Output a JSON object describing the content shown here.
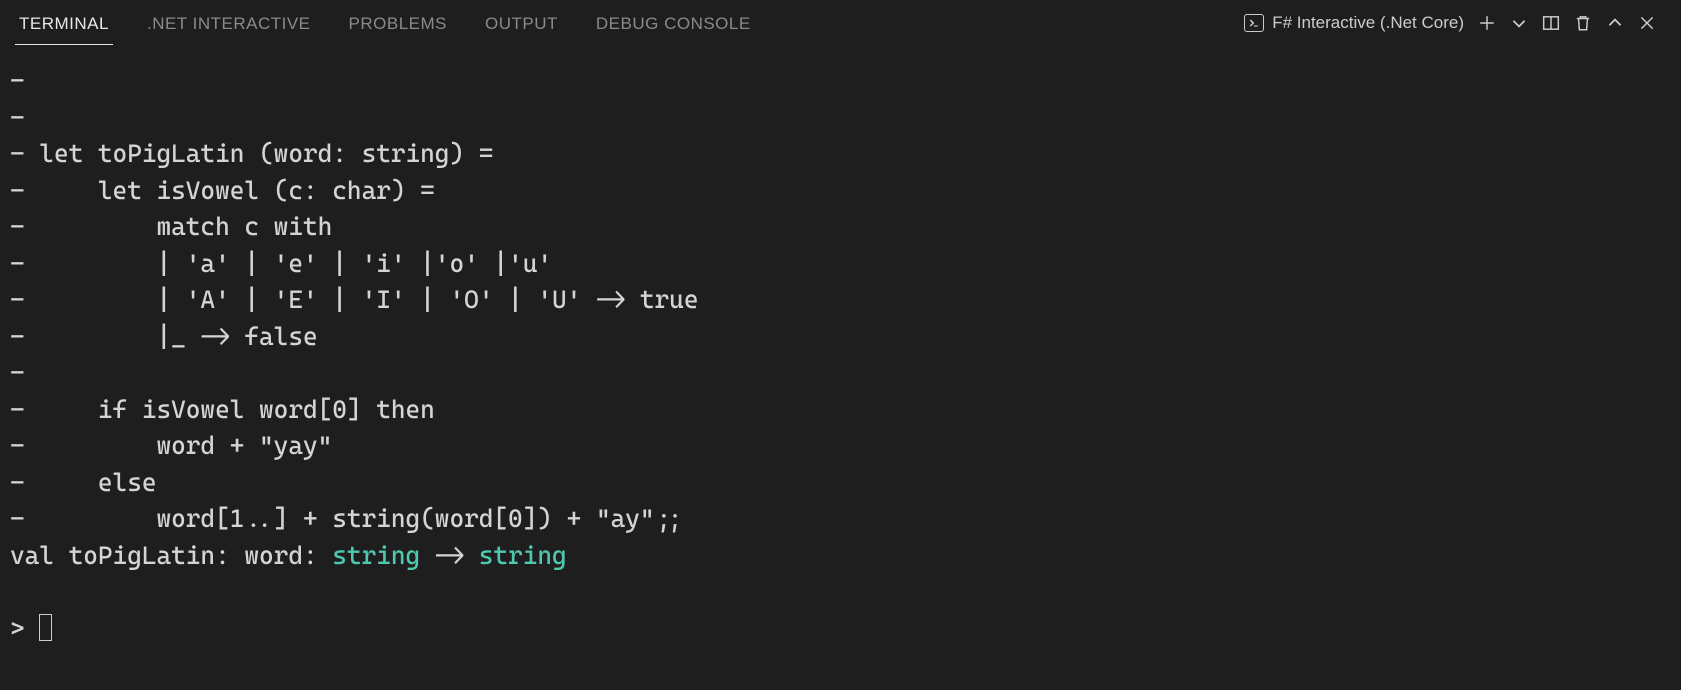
{
  "tabs": {
    "items": [
      {
        "label": "TERMINAL",
        "active": true
      },
      {
        "label": ".NET INTERACTIVE",
        "active": false
      },
      {
        "label": "PROBLEMS",
        "active": false
      },
      {
        "label": "OUTPUT",
        "active": false
      },
      {
        "label": "DEBUG CONSOLE",
        "active": false
      }
    ]
  },
  "toolbar": {
    "terminal_type_label": "F# Interactive (.Net Core)"
  },
  "terminal": {
    "lines": [
      "- ",
      "- ",
      "- let toPigLatin (word: string) =",
      "-     let isVowel (c: char) =",
      "-         match c with",
      "-         | 'a' | 'e' | 'i' |'o' |'u'",
      "-         | 'A' | 'E' | 'I' | 'O' | 'U' -> true",
      "-         |_ -> false",
      "- ",
      "-     if isVowel word[0] then",
      "-         word + \"yay\"",
      "-     else",
      "-         word[1..] + string(word[0]) + \"ay\";;"
    ],
    "val_prefix": "val toPigLatin: word: ",
    "val_type1": "string",
    "val_arrow": " -> ",
    "val_type2": "string",
    "prompt": "> "
  }
}
